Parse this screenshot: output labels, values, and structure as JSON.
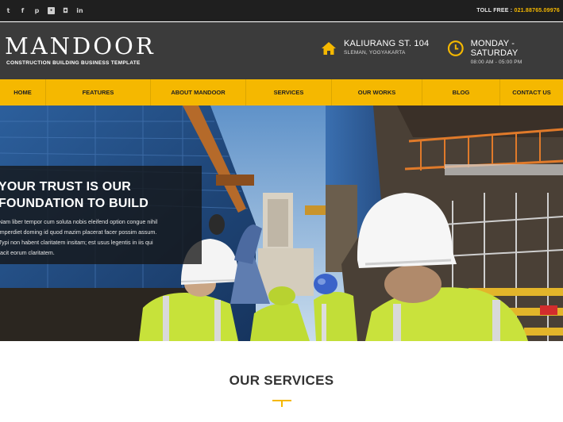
{
  "topbar": {
    "social_icons": [
      "twitter-icon",
      "facebook-icon",
      "pinterest-icon",
      "flickr-icon",
      "instagram-icon",
      "linkedin-icon"
    ],
    "social_glyphs": [
      "t",
      "f",
      "p",
      "•",
      "◘",
      "in"
    ],
    "toll_free_label": "TOLL FREE :",
    "toll_free_number": "021.88765.09976"
  },
  "header": {
    "logo": "MANDOOR",
    "tagline": "CONSTRUCTION BUILDING BUSINESS TEMPLATE",
    "address_title": "KALIURANG ST. 104",
    "address_sub": "SLEMAN, YOGYAKARTA",
    "hours_title": "MONDAY - SATURDAY",
    "hours_sub": "08:00 AM - 05:00 PM"
  },
  "nav": {
    "items": [
      "HOME",
      "FEATURES",
      "ABOUT MANDOOR",
      "SERVICES",
      "OUR WORKS",
      "BLOG",
      "CONTACT US"
    ]
  },
  "hero": {
    "title_line1": "YOUR TRUST IS OUR",
    "title_line2": "FOUNDATION TO BUILD",
    "body_line1": "Nam liber tempor cum soluta nobis eleifend option congue nihil",
    "body_line2": "imperdiet doming id quod mazim placerat facer possim assum.",
    "body_line3": "Typi non habent claritatem insitam; est usus legentis in iis qui",
    "body_line4": "facit eorum claritatem."
  },
  "services": {
    "title": "OUR SERVICES"
  },
  "colors": {
    "accent": "#f5b800",
    "header_bg": "#3b3b3b",
    "topbar_bg": "#1f1f1f"
  }
}
